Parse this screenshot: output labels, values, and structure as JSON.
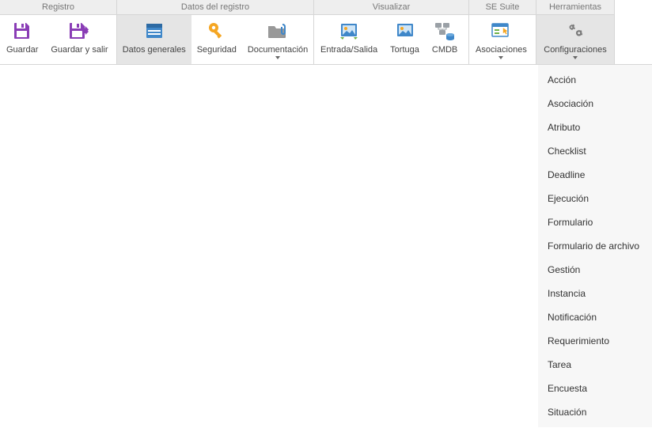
{
  "groups": {
    "registro": {
      "header": "Registro"
    },
    "datos": {
      "header": "Datos del registro"
    },
    "visualizar": {
      "header": "Visualizar"
    },
    "sesuite": {
      "header": "SE Suite"
    },
    "herramientas": {
      "header": "Herramientas"
    }
  },
  "buttons": {
    "guardar": "Guardar",
    "guardar_salir": "Guardar y salir",
    "datos_generales": "Datos generales",
    "seguridad": "Seguridad",
    "documentacion": "Documentación",
    "entrada_salida": "Entrada/Salida",
    "tortuga": "Tortuga",
    "cmdb": "CMDB",
    "asociaciones": "Asociaciones",
    "configuraciones": "Configuraciones"
  },
  "menu": {
    "items": [
      "Acción",
      "Asociación",
      "Atributo",
      "Checklist",
      "Deadline",
      "Ejecución",
      "Formulario",
      "Formulario de archivo",
      "Gestión",
      "Instancia",
      "Notificación",
      "Requerimiento",
      "Tarea",
      "Encuesta",
      "Situación"
    ]
  }
}
